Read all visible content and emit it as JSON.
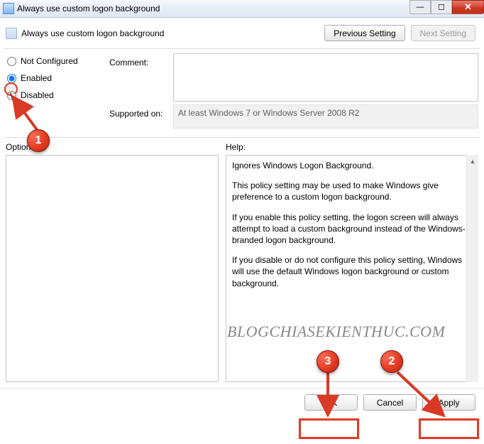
{
  "titlebar": {
    "title": "Always use custom logon background"
  },
  "header": {
    "policy_name": "Always use custom logon background",
    "previous_btn": "Previous Setting",
    "next_btn": "Next Setting"
  },
  "radios": {
    "not_configured": "Not Configured",
    "enabled": "Enabled",
    "disabled": "Disabled",
    "selected": "enabled"
  },
  "fields": {
    "comment_label": "Comment:",
    "comment_value": "",
    "supported_label": "Supported on:",
    "supported_value": "At least Windows 7 or Windows Server 2008 R2"
  },
  "labels": {
    "options": "Options:",
    "help": "Help:"
  },
  "help_paragraphs": [
    "Ignores Windows Logon Background.",
    "This policy setting may be used to make Windows give preference to a custom logon background.",
    "If you enable this policy setting, the logon screen will always attempt to load a custom background instead of the Windows-branded logon background.",
    "If you disable or do not configure this policy setting, Windows will use the default Windows logon background or custom background."
  ],
  "footer": {
    "ok": "OK",
    "cancel": "Cancel",
    "apply": "Apply"
  },
  "annotations": {
    "badge1": "1",
    "badge2": "2",
    "badge3": "3",
    "watermark": "BLOGCHIASEKIENTHUC.COM"
  }
}
